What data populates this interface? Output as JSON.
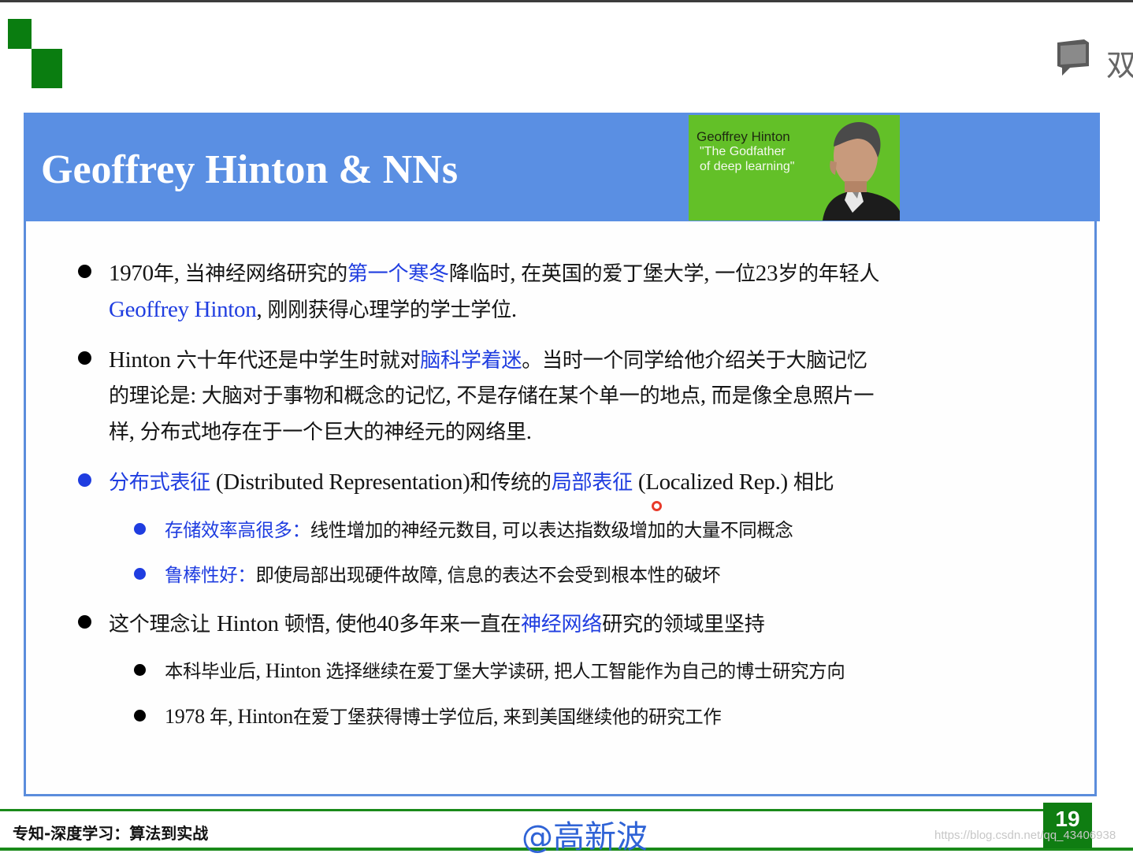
{
  "corner": {
    "text": "双"
  },
  "slide": {
    "title": "Geoffrey Hinton & NNs",
    "photo_caption": [
      "Geoffrey Hinton",
      "\"The Godfather",
      "of deep learning\""
    ]
  },
  "bullets": {
    "b1": {
      "l1": [
        "1970",
        "年",
        ", ",
        "当神经网络研究的",
        "第一个寒冬",
        "降临时",
        ", ",
        "在英国的爱丁堡大学",
        ", ",
        "一位",
        "23",
        "岁的年轻人"
      ],
      "l2": [
        "Geoffrey Hinton",
        ", ",
        "刚刚获得心理学的学士学位",
        "."
      ]
    },
    "b2": {
      "l1": [
        "Hinton ",
        "六十年代还是中学生时就对",
        "脑科学着迷",
        "。当时一个同学给他介绍关于大脑记忆"
      ],
      "l2": [
        "的理论是",
        ": ",
        "大脑对于事物和概念的记忆",
        ", ",
        "不是存储在某个单一的地点",
        ", ",
        "而是像全息照片一"
      ],
      "l3": [
        "样",
        ", ",
        "分布式地存在于一个巨大的神经元的网络里",
        "."
      ]
    },
    "b3": {
      "l1": [
        "分布式表征",
        " (Distributed Representation)",
        "和传统的",
        "局部表征",
        " (Localized Rep.) ",
        "相比"
      ],
      "s1": [
        "存储效率高很多",
        "：",
        "线性增加的神经元数目",
        ", ",
        "可以表达指数级增加的大量不同概念"
      ],
      "s2": [
        "鲁棒性好",
        "：",
        "即使局部出现硬件故障",
        ", ",
        "信息的表达不会受到根本性的破坏"
      ]
    },
    "b4": {
      "l1": [
        "这个理念让 ",
        "Hinton ",
        "顿悟",
        ", ",
        "使他",
        "40",
        "多年来一直在",
        "神经网络",
        "研究的领域里坚持"
      ],
      "s1": [
        "本科毕业后",
        ", ",
        "Hinton ",
        "选择继续在爱丁堡大学读研",
        ", ",
        "把人工智能作为自己的博士研究方向"
      ],
      "s2": [
        "1978 ",
        "年",
        ", ",
        "Hinton",
        "在爱丁堡获得博士学位后",
        ", ",
        "来到美国继续他的研究工作"
      ]
    }
  },
  "footer": {
    "left": "专知-深度学习：算法到实战",
    "center": "@高新波",
    "page": "19",
    "watermark": "https://blog.csdn.net/qq_43406938"
  },
  "colors": {
    "accent": "#5a8fe3",
    "highlight": "#1f3de0",
    "brand_green": "#0f7d12"
  }
}
